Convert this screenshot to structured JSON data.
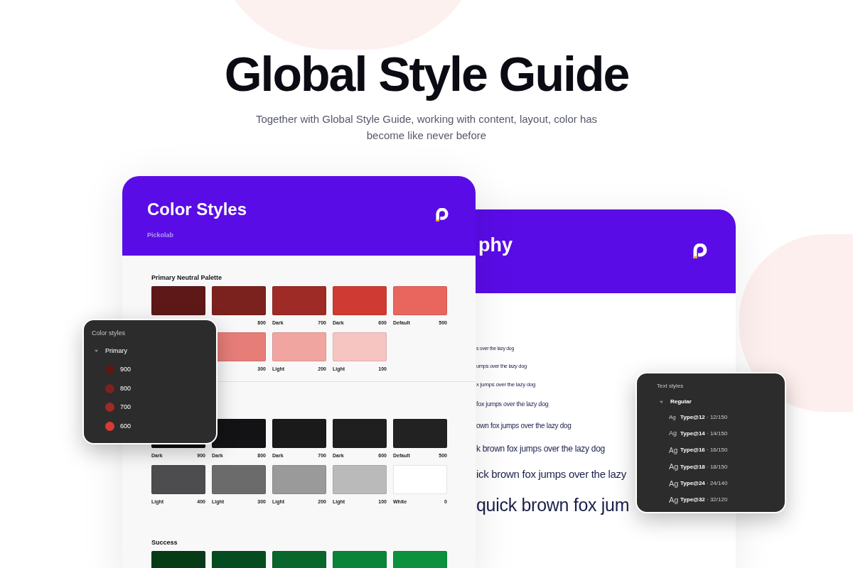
{
  "heading": {
    "title": "Global Style Guide",
    "subtitle": "Together with Global Style Guide, working with content, layout, color has become like never before"
  },
  "typography_card": {
    "title": "phy",
    "samples": [
      "s over the lazy dog",
      "umps over the lazy dog",
      "x jumps over the lazy dog",
      "fox jumps over the lazy dog",
      "own fox jumps over the lazy dog",
      "k brown fox jumps over the lazy dog",
      "ick brown fox jumps over the lazy",
      "quick brown fox jum"
    ]
  },
  "color_card": {
    "title": "Color Styles",
    "subtitle": "Pickolab",
    "palettes": [
      {
        "title": "Primary Neutral Palette",
        "rows": [
          [
            {
              "color": "#5e1818"
            },
            {
              "color": "#7c221e",
              "value": "800"
            },
            {
              "color": "#9e2b26",
              "label": "Dark",
              "value": "700"
            },
            {
              "color": "#cf3a33",
              "label": "Dark",
              "value": "600"
            },
            {
              "color": "#e8665e",
              "label": "Default",
              "value": "500"
            }
          ],
          [
            {},
            {
              "color": "#e77d78",
              "value": "300"
            },
            {
              "color": "#f1a5a0",
              "label": "Light",
              "value": "200"
            },
            {
              "color": "#f6c4c1",
              "label": "Light",
              "value": "100"
            }
          ]
        ]
      },
      {
        "rows": [
          [
            {
              "color": "#0e0e12",
              "label": "Dark",
              "value": "900"
            },
            {
              "color": "#131316",
              "label": "Dark",
              "value": "800"
            },
            {
              "color": "#1a1a1a",
              "label": "Dark",
              "value": "700"
            },
            {
              "color": "#1f1f1f",
              "label": "Dark",
              "value": "600"
            },
            {
              "color": "#222222",
              "label": "Default",
              "value": "500"
            }
          ],
          [
            {
              "color": "#4d4d4f",
              "label": "Light",
              "value": "400"
            },
            {
              "color": "#6b6b6b",
              "label": "Light",
              "value": "300"
            },
            {
              "color": "#9a9a9a",
              "label": "Light",
              "value": "200"
            },
            {
              "color": "#bababa",
              "label": "Light",
              "value": "100"
            },
            {
              "color": "#ffffff",
              "label": "White",
              "value": "0"
            }
          ]
        ]
      },
      {
        "title": "Success",
        "rows": [
          [
            {
              "color": "#063b18"
            },
            {
              "color": "#054d20"
            },
            {
              "color": "#09672c"
            },
            {
              "color": "#0a8538"
            },
            {
              "color": "#0c913d"
            }
          ]
        ]
      }
    ]
  },
  "color_styles_panel": {
    "title": "Color styles",
    "group": {
      "label": "Primary",
      "expanded": true,
      "items": [
        {
          "label": "900",
          "color": "#5e1818"
        },
        {
          "label": "800",
          "color": "#7c221e"
        },
        {
          "label": "700",
          "color": "#9e2b26"
        },
        {
          "label": "600",
          "color": "#d63b33"
        }
      ]
    }
  },
  "text_styles_panel": {
    "title": "Text styles",
    "group": {
      "label": "Regular",
      "expanded": true,
      "items": [
        {
          "sample": "Ag",
          "name": "**Type@12** · 12/150"
        },
        {
          "sample": "Ag",
          "name": "**Type@14** · 14/150"
        },
        {
          "sample": "Ag",
          "name": "**Type@16** · 16/150"
        },
        {
          "sample": "Ag",
          "name": "**Type@18** · 18/150"
        },
        {
          "sample": "Ag",
          "name": "**Type@24** · 24/140"
        },
        {
          "sample": "Ag",
          "name": "**Type@32** · 32/120"
        }
      ]
    }
  }
}
